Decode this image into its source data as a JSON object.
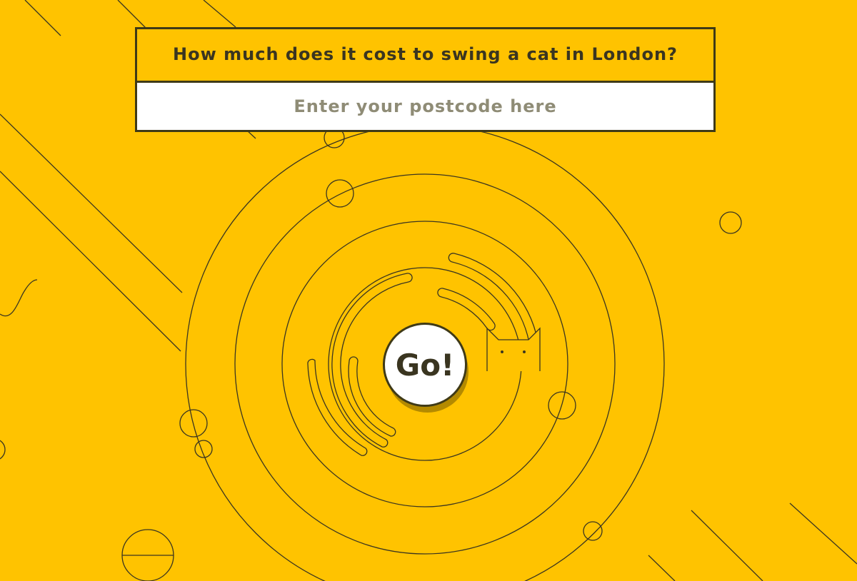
{
  "question": {
    "text": "How much does it cost to swing a cat in London?"
  },
  "postcode": {
    "value": "",
    "placeholder": "Enter your postcode here"
  },
  "go_button": {
    "label": "Go!"
  },
  "decorations": {
    "cat_icon": "cat-peeking-icon"
  },
  "colors": {
    "background": "#ffc300",
    "line": "#3a3520",
    "input_background": "#ffffff",
    "placeholder": "#8f8c76"
  }
}
